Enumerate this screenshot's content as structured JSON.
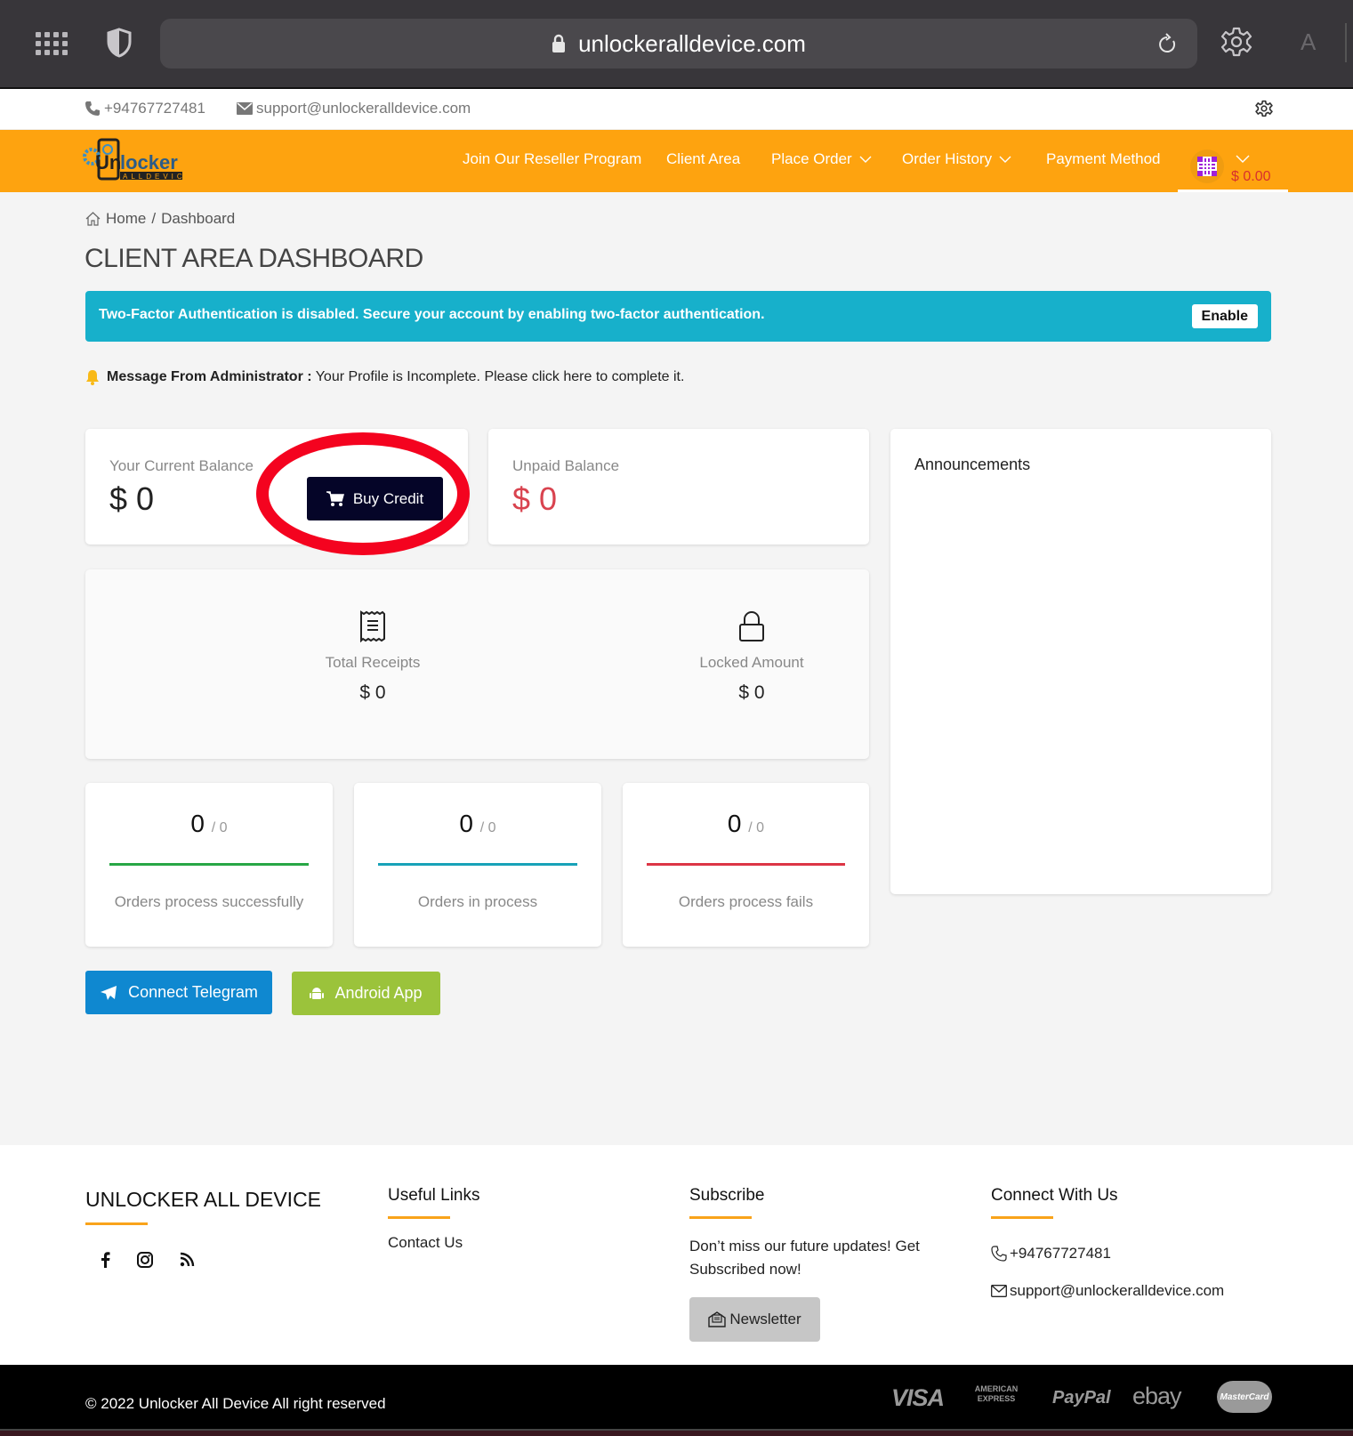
{
  "browser": {
    "url": "unlockeralldevice.com",
    "reader_label": "A"
  },
  "topbar": {
    "phone": "+94767727481",
    "email": "support@unlockeralldevice.com"
  },
  "navbar": {
    "links": [
      {
        "label": "Join Our Reseller Program",
        "dropdown": false
      },
      {
        "label": "Client Area",
        "dropdown": false
      },
      {
        "label": "Place Order",
        "dropdown": true
      },
      {
        "label": "Order History",
        "dropdown": true
      },
      {
        "label": "Payment Method",
        "dropdown": false
      }
    ],
    "balance": "$ 0.00"
  },
  "breadcrumb": {
    "home": "Home",
    "separator": "/",
    "current": "Dashboard"
  },
  "page_title": "CLIENT AREA DASHBOARD",
  "alert": {
    "text": "Two-Factor Authentication is disabled. Secure your account by enabling two-factor authentication.",
    "button": "Enable"
  },
  "admin_message": {
    "label": "Message From Administrator :",
    "text": "Your Profile is Incomplete. Please click here to complete it."
  },
  "balance": {
    "current_label": "Your Current Balance",
    "current_value": "$ 0",
    "buy_credit": "Buy Credit",
    "unpaid_label": "Unpaid Balance",
    "unpaid_value": "$ 0"
  },
  "stats": {
    "receipts_label": "Total Receipts",
    "receipts_value": "$ 0",
    "locked_label": "Locked Amount",
    "locked_value": "$ 0"
  },
  "orders": [
    {
      "count": "0",
      "total": "/ 0",
      "caption": "Orders process successfully",
      "color": "#28a745"
    },
    {
      "count": "0",
      "total": "/ 0",
      "caption": "Orders in process",
      "color": "#17a2b8"
    },
    {
      "count": "0",
      "total": "/ 0",
      "caption": "Orders process fails",
      "color": "#dc3545"
    }
  ],
  "announcements": {
    "title": "Announcements"
  },
  "actions": {
    "telegram": "Connect Telegram",
    "android": "Android App"
  },
  "footer": {
    "brand": "UNLOCKER ALL DEVICE",
    "useful_links_title": "Useful Links",
    "useful_links": [
      "Contact Us"
    ],
    "subscribe_title": "Subscribe",
    "subscribe_text": "Don’t miss our future updates! Get Subscribed now!",
    "newsletter_button": "Newsletter",
    "connect_title": "Connect With Us",
    "phone": "+94767727481",
    "email": "support@unlockeralldevice.com",
    "copyright": "© 2022 Unlocker All Device All right reserved",
    "payment_methods": [
      "VISA",
      "AMERICAN EXPRESS",
      "PayPal",
      "ebay",
      "MasterCard"
    ]
  },
  "colors": {
    "brand_orange": "#fea30f",
    "alert_cyan": "#17b0cb",
    "buy_credit_navy": "#050528",
    "telegram_blue": "#0f88d0",
    "android_green": "#9bc33b",
    "unpaid_red": "#d9434f",
    "annotation_red": "#f4031f"
  }
}
